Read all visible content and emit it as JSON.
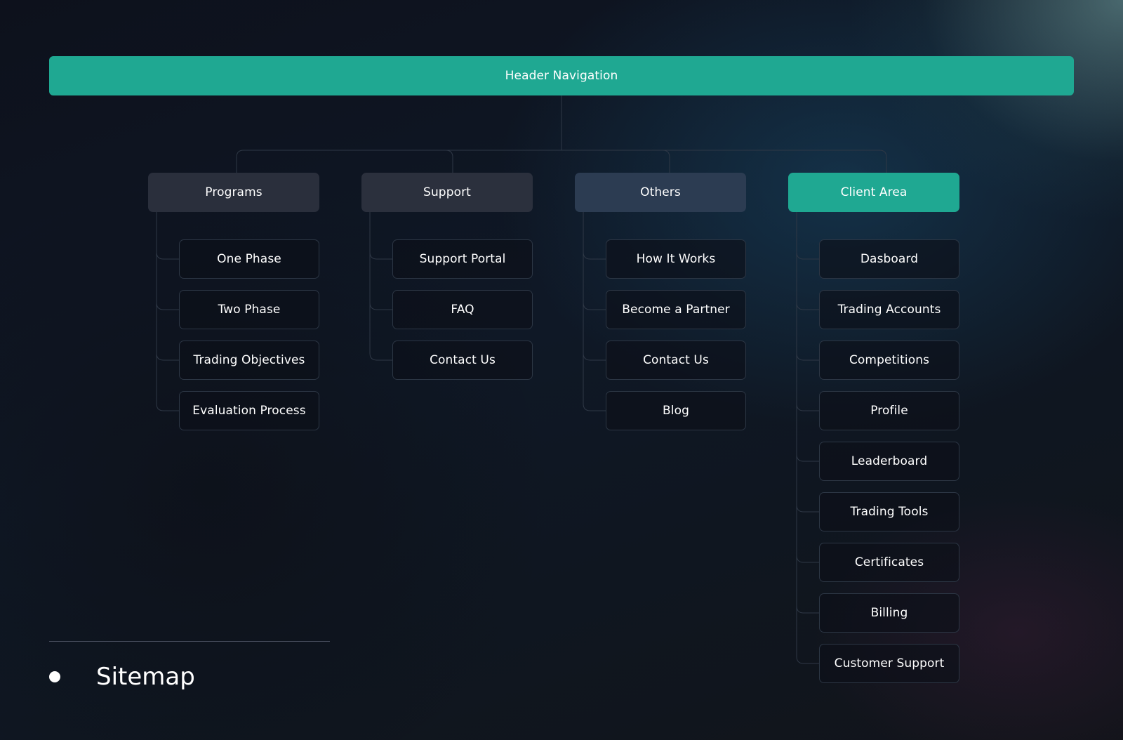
{
  "header_navigation": {
    "label": "Header Navigation",
    "color": "#1fa892"
  },
  "categories": [
    {
      "label": "Programs",
      "children": [
        "One Phase",
        "Two Phase",
        "Trading Objectives",
        "Evaluation Process"
      ]
    },
    {
      "label": "Support",
      "children": [
        "Support Portal",
        "FAQ",
        "Contact Us"
      ]
    },
    {
      "label": "Others",
      "children": [
        "How It Works",
        "Become a Partner",
        "Contact Us",
        "Blog"
      ]
    },
    {
      "label": "Client Area",
      "highlighted": true,
      "children": [
        "Dasboard",
        "Trading Accounts",
        "Competitions",
        "Profile",
        "Leaderboard",
        "Trading Tools",
        "Certificates",
        "Billing",
        "Customer Support"
      ]
    }
  ],
  "footer": {
    "title": "Sitemap"
  },
  "colors": {
    "accent": "#1fa892",
    "connector": "#2f3846"
  }
}
